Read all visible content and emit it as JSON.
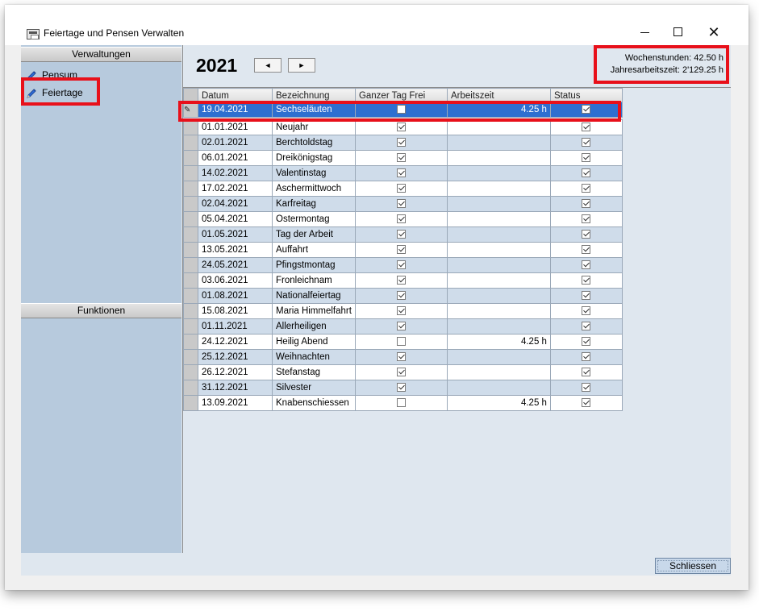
{
  "window": {
    "title": "Feiertage und Pensen Verwalten"
  },
  "sidebar": {
    "groups": [
      {
        "label": "Verwaltungen"
      },
      {
        "label": "Funktionen"
      }
    ],
    "items": [
      {
        "label": "Pensum",
        "icon": "pencil-icon"
      },
      {
        "label": "Feiertage",
        "icon": "pencil-icon"
      }
    ]
  },
  "header": {
    "year": "2021",
    "prev_label": "◄",
    "next_label": "►",
    "weekly_hours": "Wochenstunden: 42.50 h",
    "annual_hours": "Jahresarbeitszeit: 2'129.25 h"
  },
  "grid": {
    "columns": [
      "Datum",
      "Bezeichnung",
      "Ganzer Tag Frei",
      "Arbeitszeit",
      "Status"
    ],
    "edit_row": {
      "datum": "19.04.2021",
      "bezeichnung": "Sechseläuten",
      "ganzer_tag_frei": false,
      "arbeitszeit": "4.25 h",
      "status": true
    },
    "rows": [
      {
        "datum": "01.01.2021",
        "bezeichnung": "Neujahr",
        "ganzer_tag_frei": true,
        "arbeitszeit": "",
        "status": true
      },
      {
        "datum": "02.01.2021",
        "bezeichnung": "Berchtoldstag",
        "ganzer_tag_frei": true,
        "arbeitszeit": "",
        "status": true
      },
      {
        "datum": "06.01.2021",
        "bezeichnung": "Dreikönigstag",
        "ganzer_tag_frei": true,
        "arbeitszeit": "",
        "status": true
      },
      {
        "datum": "14.02.2021",
        "bezeichnung": "Valentinstag",
        "ganzer_tag_frei": true,
        "arbeitszeit": "",
        "status": true
      },
      {
        "datum": "17.02.2021",
        "bezeichnung": "Aschermittwoch",
        "ganzer_tag_frei": true,
        "arbeitszeit": "",
        "status": true
      },
      {
        "datum": "02.04.2021",
        "bezeichnung": "Karfreitag",
        "ganzer_tag_frei": true,
        "arbeitszeit": "",
        "status": true
      },
      {
        "datum": "05.04.2021",
        "bezeichnung": "Ostermontag",
        "ganzer_tag_frei": true,
        "arbeitszeit": "",
        "status": true
      },
      {
        "datum": "01.05.2021",
        "bezeichnung": "Tag der Arbeit",
        "ganzer_tag_frei": true,
        "arbeitszeit": "",
        "status": true
      },
      {
        "datum": "13.05.2021",
        "bezeichnung": "Auffahrt",
        "ganzer_tag_frei": true,
        "arbeitszeit": "",
        "status": true
      },
      {
        "datum": "24.05.2021",
        "bezeichnung": "Pfingstmontag",
        "ganzer_tag_frei": true,
        "arbeitszeit": "",
        "status": true
      },
      {
        "datum": "03.06.2021",
        "bezeichnung": "Fronleichnam",
        "ganzer_tag_frei": true,
        "arbeitszeit": "",
        "status": true
      },
      {
        "datum": "01.08.2021",
        "bezeichnung": "Nationalfeiertag",
        "ganzer_tag_frei": true,
        "arbeitszeit": "",
        "status": true
      },
      {
        "datum": "15.08.2021",
        "bezeichnung": "Maria Himmelfahrt",
        "ganzer_tag_frei": true,
        "arbeitszeit": "",
        "status": true
      },
      {
        "datum": "01.11.2021",
        "bezeichnung": "Allerheiligen",
        "ganzer_tag_frei": true,
        "arbeitszeit": "",
        "status": true
      },
      {
        "datum": "24.12.2021",
        "bezeichnung": "Heilig Abend",
        "ganzer_tag_frei": false,
        "arbeitszeit": "4.25 h",
        "status": true
      },
      {
        "datum": "25.12.2021",
        "bezeichnung": "Weihnachten",
        "ganzer_tag_frei": true,
        "arbeitszeit": "",
        "status": true
      },
      {
        "datum": "26.12.2021",
        "bezeichnung": "Stefanstag",
        "ganzer_tag_frei": true,
        "arbeitszeit": "",
        "status": true
      },
      {
        "datum": "31.12.2021",
        "bezeichnung": "Silvester",
        "ganzer_tag_frei": true,
        "arbeitszeit": "",
        "status": true
      },
      {
        "datum": "13.09.2021",
        "bezeichnung": "Knabenschiessen",
        "ganzer_tag_frei": false,
        "arbeitszeit": "4.25 h",
        "status": true
      }
    ]
  },
  "footer": {
    "close_label": "Schliessen"
  },
  "colors": {
    "selection": "#2e6fd0",
    "highlight": "#e8101a",
    "sidebar_bg": "#b7cadd",
    "row_alt": "#cfdcea"
  }
}
